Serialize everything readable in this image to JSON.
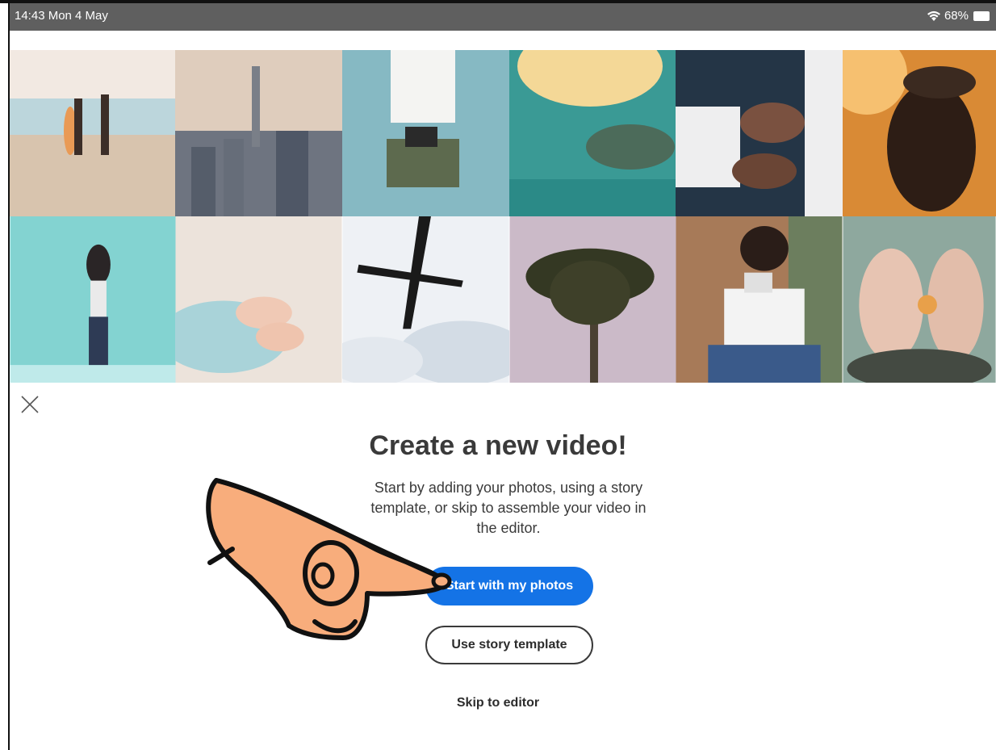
{
  "status_bar": {
    "time": "14:43  Mon 4 May",
    "battery": "68%"
  },
  "photo_grid": {
    "tiles": [
      {
        "name": "photo-beach-surfers",
        "colors": [
          "#f0e7df",
          "#cbb9a6"
        ]
      },
      {
        "name": "photo-city-skyline",
        "colors": [
          "#d9c8b9",
          "#5d6470"
        ]
      },
      {
        "name": "photo-woman-camera",
        "colors": [
          "#7fb2bd",
          "#5a6b55"
        ]
      },
      {
        "name": "photo-sea-turtle",
        "colors": [
          "#f3d48f",
          "#2e8c88"
        ]
      },
      {
        "name": "photo-suit-cufflinks",
        "colors": [
          "#2a3b4c",
          "#e9e9ec"
        ]
      },
      {
        "name": "photo-man-cap-sunset",
        "colors": [
          "#f0a040",
          "#2b1c14"
        ]
      },
      {
        "name": "photo-mother-child",
        "colors": [
          "#7fd0d0",
          "#2c3850"
        ]
      },
      {
        "name": "photo-baby-feet",
        "colors": [
          "#e9dfd7",
          "#a6cdd4"
        ]
      },
      {
        "name": "photo-airplane-sky",
        "colors": [
          "#eef1f4",
          "#9fb0c0"
        ]
      },
      {
        "name": "photo-palm-tree",
        "colors": [
          "#c8b7c6",
          "#3a3826"
        ]
      },
      {
        "name": "photo-man-polaroid",
        "colors": [
          "#b88a6a",
          "#2e4b78"
        ]
      },
      {
        "name": "photo-hands-flower",
        "colors": [
          "#8aa79b",
          "#e6c3b3"
        ]
      }
    ]
  },
  "dialog": {
    "title": "Create a new video!",
    "subtitle": "Start by adding your photos, using a story template, or skip to assemble your video in the editor.",
    "primary_button": "Start with my photos",
    "secondary_button": "Use story template",
    "skip_link": "Skip to editor"
  },
  "colors": {
    "accent": "#1473e6",
    "status_bar": "#5f5f5f"
  }
}
